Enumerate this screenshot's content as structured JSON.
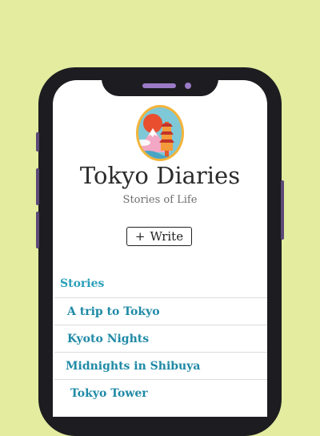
{
  "app": {
    "title": "Tokyo Diaries",
    "subtitle": "Stories of Life",
    "write_icon": "+",
    "write_label": "Write"
  },
  "stories": {
    "heading": "Stories",
    "items": [
      {
        "label": "A trip to Tokyo"
      },
      {
        "label": "Kyoto Nights"
      },
      {
        "label": "Midnights in Shibuya"
      },
      {
        "label": "Tokyo Tower"
      }
    ]
  },
  "colors": {
    "background": "#e3ec9f",
    "phone_frame": "#1d1c20",
    "accent": "#2aa0b8",
    "link": "#1f8aa6"
  }
}
